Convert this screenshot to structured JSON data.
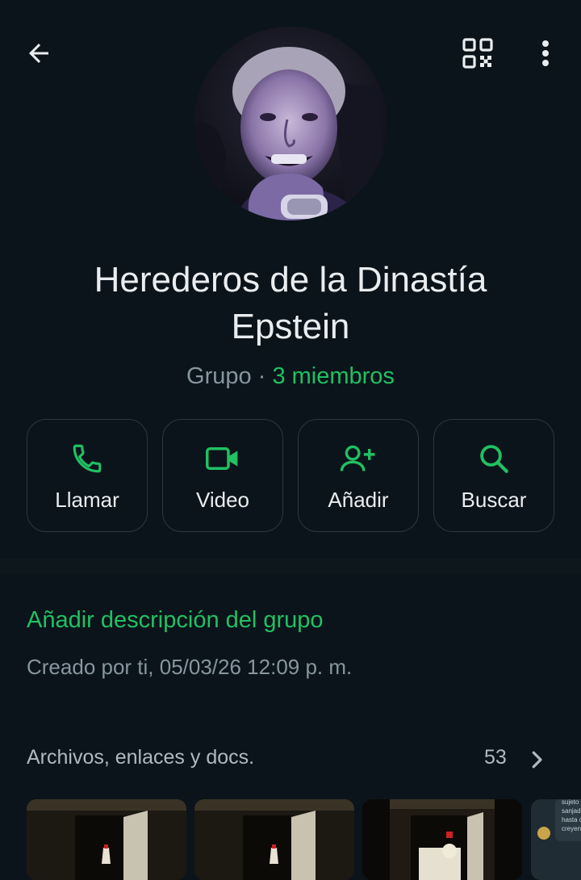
{
  "header": {
    "back_icon": "arrow-left-icon",
    "qr_icon": "qr-code-icon",
    "more_icon": "more-vertical-icon"
  },
  "group": {
    "name": "Herederos de la Dinastía Epstein",
    "type_label": "Grupo",
    "separator": " · ",
    "members_label": "3 miembros"
  },
  "actions": [
    {
      "label": "Llamar",
      "icon": "phone-icon"
    },
    {
      "label": "Video",
      "icon": "video-icon"
    },
    {
      "label": "Añadir",
      "icon": "add-person-icon"
    },
    {
      "label": "Buscar",
      "icon": "search-icon"
    }
  ],
  "description": {
    "add_link": "Añadir descripción del grupo",
    "created": "Creado por ti, 05/03/26 12:09 p. m."
  },
  "media": {
    "header": "Archivos, enlaces y docs.",
    "count": "53",
    "chat_preview_text": "sujeto\nsanjad\nhasta c\ncreyen"
  },
  "colors": {
    "background": "#0b141a",
    "accent_green": "#21c063",
    "secondary_text": "#8696a0",
    "border": "#2a3942"
  }
}
